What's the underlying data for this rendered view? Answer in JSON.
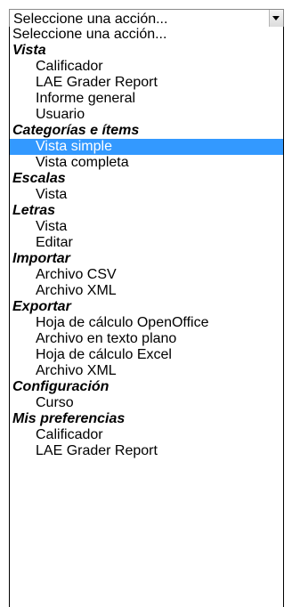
{
  "select": {
    "current_value": "Seleccione una acción..."
  },
  "dropdown": {
    "placeholder_option": "Seleccione una acción...",
    "groups": [
      {
        "label": "Vista",
        "options": [
          "Calificador",
          "LAE Grader Report",
          "Informe general",
          "Usuario"
        ]
      },
      {
        "label": "Categorías e ítems",
        "options": [
          "Vista simple",
          "Vista completa"
        ]
      },
      {
        "label": "Escalas",
        "options": [
          "Vista"
        ]
      },
      {
        "label": "Letras",
        "options": [
          "Vista",
          "Editar"
        ]
      },
      {
        "label": "Importar",
        "options": [
          "Archivo CSV",
          "Archivo XML"
        ]
      },
      {
        "label": "Exportar",
        "options": [
          "Hoja de cálculo OpenOffice",
          "Archivo en texto plano",
          "Hoja de cálculo Excel",
          "Archivo XML"
        ]
      },
      {
        "label": "Configuración",
        "options": [
          "Curso"
        ]
      },
      {
        "label": "Mis preferencias",
        "options": [
          "Calificador",
          "LAE Grader Report"
        ]
      }
    ],
    "highlighted_option": "Vista simple",
    "highlight_color": "#3399ff"
  }
}
